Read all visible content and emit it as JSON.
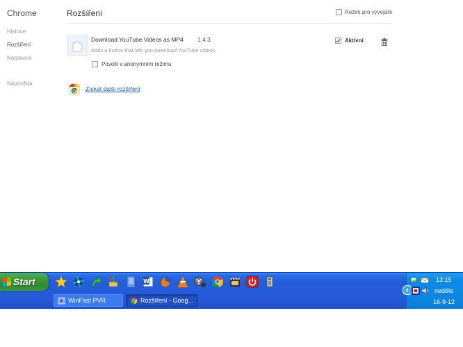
{
  "sidebar": {
    "brand": "Chrome",
    "items": [
      {
        "label": "Historie"
      },
      {
        "label": "Rozšíření"
      },
      {
        "label": "Nastavení"
      }
    ],
    "help": "Nápověda"
  },
  "header": {
    "title": "Rozšíření",
    "dev_mode_label": "Režim pro vývojáře",
    "dev_mode_checked": false
  },
  "extension": {
    "name": "Download YouTube Videos as MP4",
    "version": "1.4.3",
    "description": "Adds a button that lets you download YouTube videos.",
    "incognito_label": "Povolit v anonymním režimu",
    "enabled_label": "Aktivní",
    "enabled": true
  },
  "gallery_link": "Získat další rozšíření",
  "taskbar": {
    "start_label": "Start",
    "quick_launch_icons": [
      "star-icon",
      "pinwheel-icon",
      "green-arrow-icon",
      "brush-icon",
      "document-icon",
      "word-icon",
      "firefox-icon",
      "vlc-icon",
      "film-reel-icon",
      "chrome-icon",
      "clapperboard-icon",
      "power-icon",
      "tool-icon"
    ],
    "windows": [
      {
        "label": "WinFast PVR",
        "icon": "winfast-icon"
      },
      {
        "label": "Rozšíření - Goog...",
        "icon": "chrome-icon"
      }
    ],
    "tray": {
      "time": "13:15",
      "day": "neděle",
      "date": "16-9-12"
    }
  },
  "colors": {
    "taskbar_blue": "#245edb",
    "start_green": "#3c9a3c",
    "tray_blue": "#0f8ae6",
    "link_blue": "#1a55b5"
  }
}
